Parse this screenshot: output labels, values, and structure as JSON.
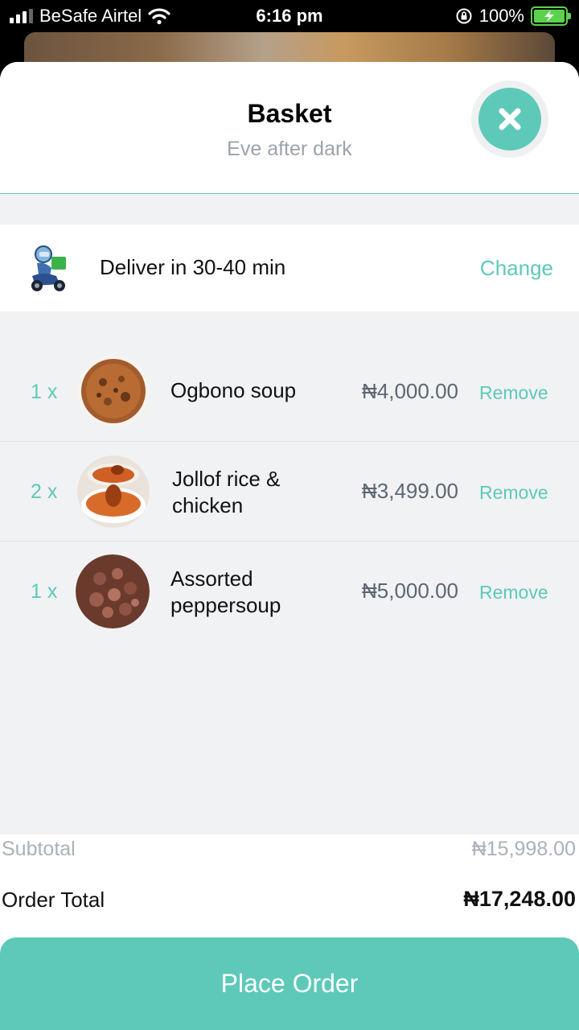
{
  "status_bar": {
    "carrier": "BeSafe Airtel",
    "time": "6:16 pm",
    "battery": "100%",
    "icons": [
      "signal-icon",
      "wifi-icon",
      "orientation-lock-icon",
      "battery-charging-icon"
    ]
  },
  "header": {
    "title": "Basket",
    "subtitle": "Eve after dark",
    "close_icon": "close-icon"
  },
  "delivery": {
    "icon": "delivery-rider-icon",
    "text": "Deliver in 30-40 min",
    "change_label": "Change"
  },
  "items": [
    {
      "qty": "1 x",
      "name": "Ogbono soup",
      "price": "₦4,000.00",
      "remove_label": "Remove",
      "image": "ogbono-soup"
    },
    {
      "qty": "2 x",
      "name": "Jollof rice & chicken",
      "price": "₦3,499.00",
      "remove_label": "Remove",
      "image": "jollof-rice-chicken"
    },
    {
      "qty": "1 x",
      "name": "Assorted peppersoup",
      "price": "₦5,000.00",
      "remove_label": "Remove",
      "image": "assorted-peppersoup"
    }
  ],
  "totals": {
    "subtotal_label": "Subtotal",
    "subtotal_value": "₦15,998.00",
    "order_total_label": "Order Total",
    "order_total_value": "₦17,248.00"
  },
  "cta": {
    "label": "Place Order"
  },
  "colors": {
    "accent": "#5ec9b8",
    "muted_text": "#9aa3ad",
    "background_gray": "#f1f2f4"
  }
}
